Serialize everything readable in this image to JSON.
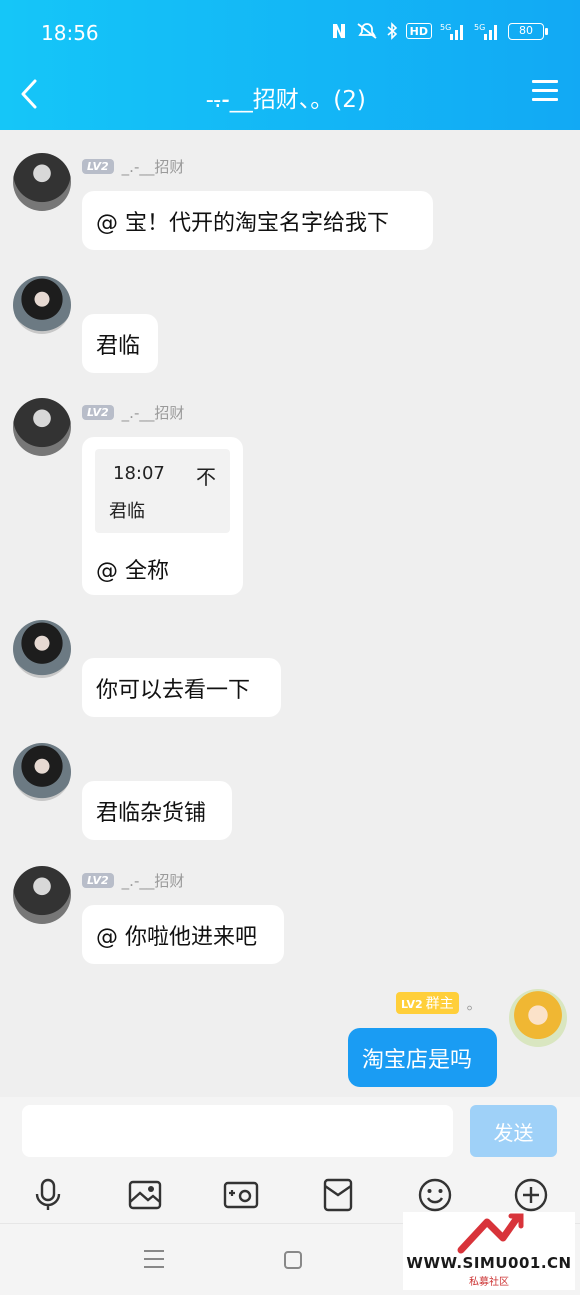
{
  "status_bar": {
    "time": "18:56",
    "icons": [
      "nfc-icon",
      "mute-icon",
      "bluetooth-icon",
      "hd-icon",
      "signal-5g-icon",
      "signal-5g-icon"
    ],
    "hd_label": "HD",
    "net1": "5G",
    "net2": "5G",
    "battery": "80"
  },
  "header": {
    "title": "̵.̵-̵__招财、。(2)"
  },
  "messages": [
    {
      "sender_level": "LV2",
      "sender_name": "_.-__招财",
      "text": "@ 宝！代开的淘宝名字给我下"
    },
    {
      "text": "君临"
    },
    {
      "sender_level": "LV2",
      "sender_name": "_.-__招财",
      "quote_time": "18:07",
      "quote_arrow": "不",
      "quote_name": "君临",
      "text": "@ 全称"
    },
    {
      "text": "你可以去看一下"
    },
    {
      "text": "君临杂货铺"
    },
    {
      "sender_level": "LV2",
      "sender_name": "_.-__招财",
      "text": "@ 你啦他进来吧"
    },
    {
      "sender_level": "LV2",
      "sender_role": "群主",
      "sender_name": "。",
      "text": "淘宝店是吗"
    }
  ],
  "input": {
    "value": "",
    "send_label": "发送"
  },
  "toolbar": [
    "mic-icon",
    "image-icon",
    "camera-icon",
    "red-packet-icon",
    "emoji-icon",
    "plus-icon"
  ],
  "watermark": {
    "text": "WWW.SIMU001.CN",
    "sub": "私募社区"
  },
  "colors": {
    "header": "#13b6f6",
    "mine_bubble": "#1a9cf3",
    "send_button": "#9fd1f8",
    "owner_badge": "#ffcf3a"
  }
}
